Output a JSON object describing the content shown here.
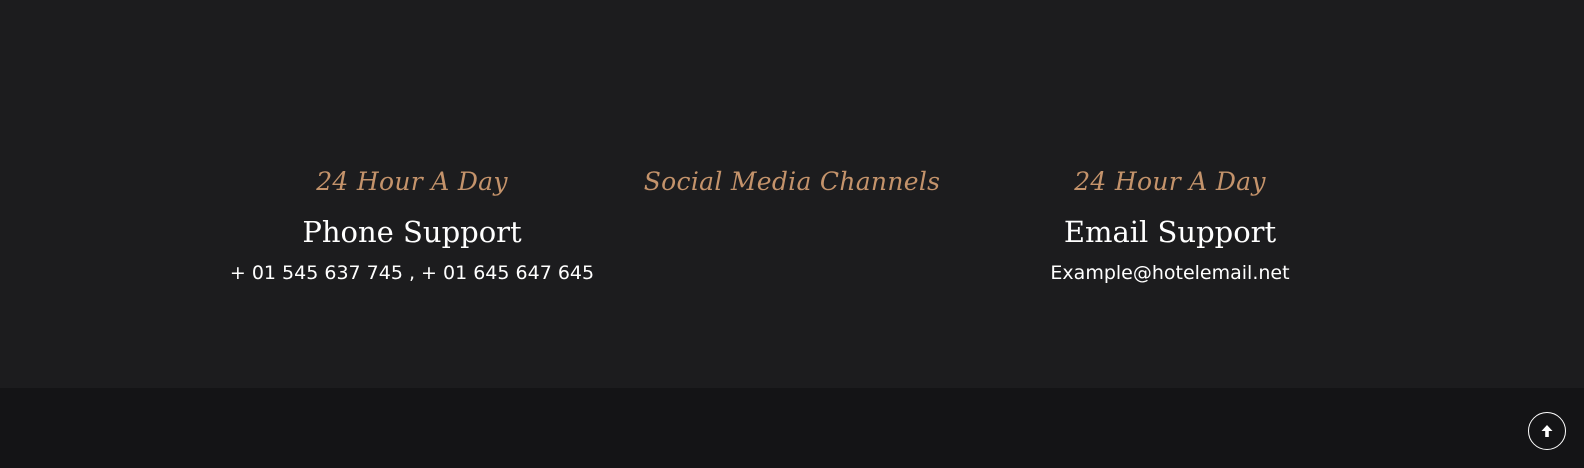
{
  "contact": {
    "phone": {
      "tagline": "24 Hour A Day",
      "heading": "Phone Support",
      "detail": "+ 01 545 637 745 , + 01 645 647 645"
    },
    "social": {
      "tagline": "Social Media Channels"
    },
    "email": {
      "tagline": "24 Hour A Day",
      "heading": "Email Support",
      "detail": "Example@hotelemail.net"
    }
  },
  "footer": {
    "scroll_top_icon": "arrow-up-icon"
  },
  "colors": {
    "section_bg": "#1c1c1e",
    "footer_bg": "#141416",
    "accent": "#c4936b",
    "text": "#ffffff"
  }
}
